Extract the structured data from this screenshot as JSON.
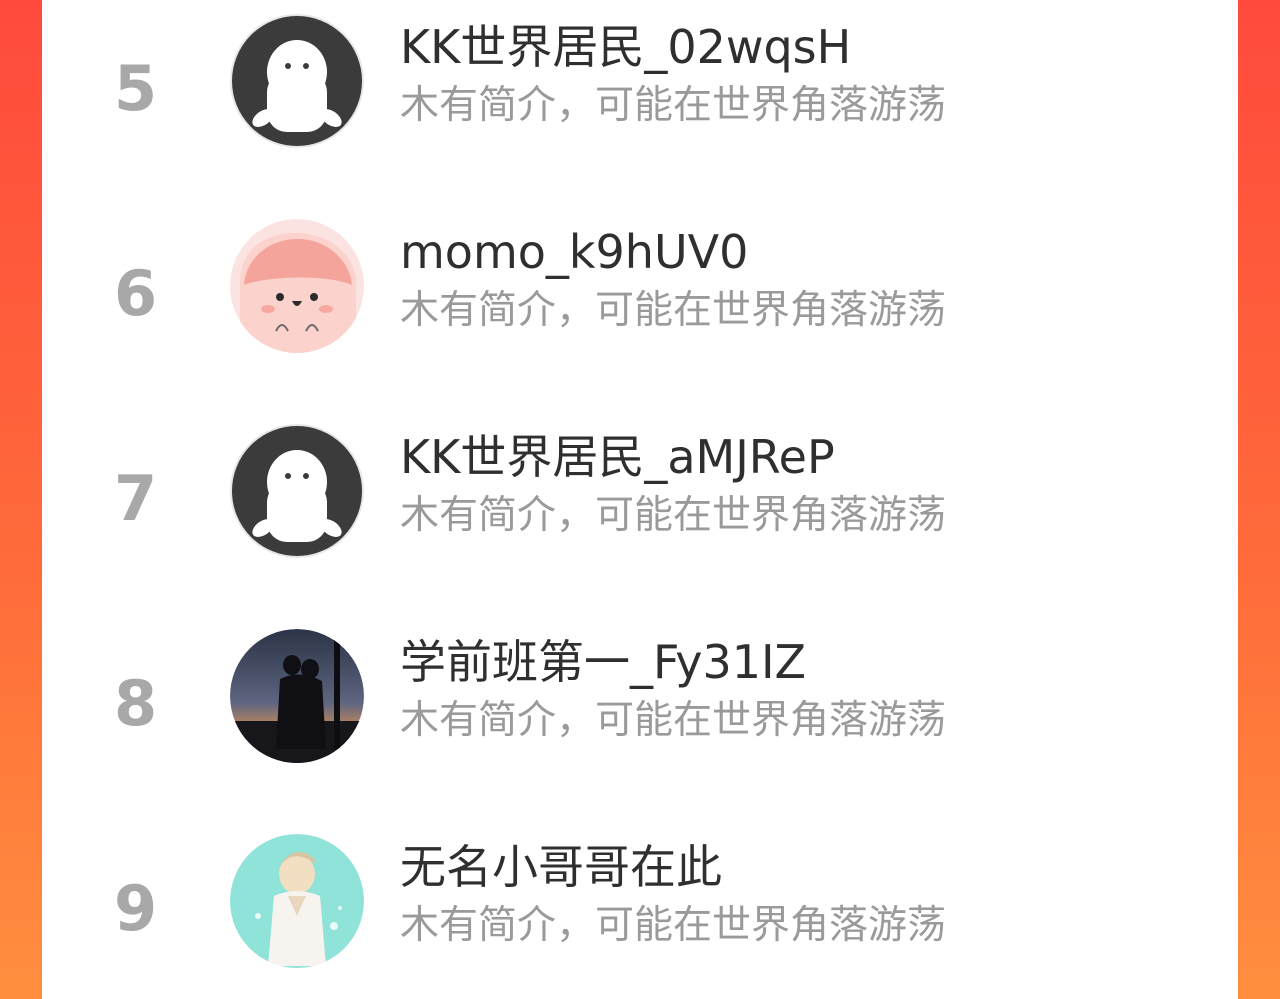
{
  "colors": {
    "accent_left": "#ff4a3d",
    "accent_right": "#ff8f3f",
    "rank_color": "#a8a8a8",
    "name_color": "#2f2f2f",
    "bio_color": "#9a9a9a"
  },
  "leaderboard": {
    "items": [
      {
        "rank": "5",
        "name": "KK世界居民_02wqsH",
        "bio": "木有简介，可能在世界角落游荡",
        "avatar": "default-ghost-avatar"
      },
      {
        "rank": "6",
        "name": "momo_k9hUV0",
        "bio": "木有简介，可能在世界角落游荡",
        "avatar": "pink-blob-avatar"
      },
      {
        "rank": "7",
        "name": "KK世界居民_aMJReP",
        "bio": "木有简介，可能在世界角落游荡",
        "avatar": "default-ghost-avatar"
      },
      {
        "rank": "8",
        "name": "学前班第一_Fy31IZ",
        "bio": "木有简介，可能在世界角落游荡",
        "avatar": "couple-sunset-avatar"
      },
      {
        "rank": "9",
        "name": "无名小哥哥在此",
        "bio": "木有简介，可能在世界角落游荡",
        "avatar": "anime-boy-avatar"
      }
    ]
  }
}
